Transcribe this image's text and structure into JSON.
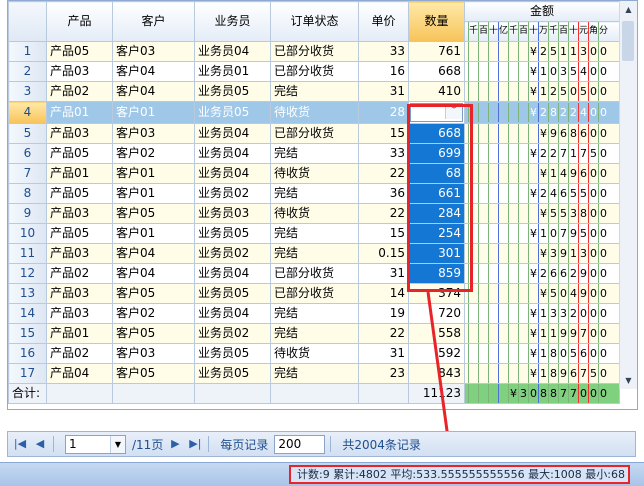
{
  "columns": {
    "product": "产品",
    "customer": "客户",
    "salesperson": "业务员",
    "status": "订单状态",
    "price": "单价",
    "qty": "数量",
    "amount": "金额",
    "amount_digits": [
      "千",
      "百",
      "十",
      "亿",
      "千",
      "百",
      "十",
      "万",
      "千",
      "百",
      "十",
      "元",
      "角",
      "分"
    ]
  },
  "rows": [
    {
      "n": "1",
      "product": "产品05",
      "customer": "客户03",
      "sales": "业务员04",
      "status": "已部分收货",
      "price": "33",
      "qty": "761",
      "amount": [
        "",
        "",
        "",
        "",
        "",
        "",
        "¥",
        "2",
        "5",
        "1",
        "1",
        "3",
        "0",
        "0"
      ]
    },
    {
      "n": "2",
      "product": "产品03",
      "customer": "客户04",
      "sales": "业务员01",
      "status": "已部分收货",
      "price": "16",
      "qty": "668",
      "amount": [
        "",
        "",
        "",
        "",
        "",
        "",
        "¥",
        "1",
        "0",
        "3",
        "5",
        "4",
        "0",
        "0"
      ]
    },
    {
      "n": "3",
      "product": "产品02",
      "customer": "客户04",
      "sales": "业务员05",
      "status": "完结",
      "price": "31",
      "qty": "410",
      "amount": [
        "",
        "",
        "",
        "",
        "",
        "",
        "¥",
        "1",
        "2",
        "5",
        "0",
        "5",
        "0",
        "0"
      ]
    },
    {
      "n": "4",
      "product": "产品01",
      "customer": "客户01",
      "sales": "业务员05",
      "status": "待收货",
      "price": "28",
      "qty": "1008",
      "amount": [
        "",
        "",
        "",
        "",
        "",
        "",
        "¥",
        "2",
        "8",
        "2",
        "2",
        "4",
        "0",
        "0"
      ]
    },
    {
      "n": "5",
      "product": "产品03",
      "customer": "客户03",
      "sales": "业务员04",
      "status": "已部分收货",
      "price": "15",
      "qty": "668",
      "amount": [
        "",
        "",
        "",
        "",
        "",
        "",
        "",
        "¥",
        "9",
        "6",
        "8",
        "6",
        "0",
        "0"
      ]
    },
    {
      "n": "6",
      "product": "产品05",
      "customer": "客户02",
      "sales": "业务员04",
      "status": "完结",
      "price": "33",
      "qty": "699",
      "amount": [
        "",
        "",
        "",
        "",
        "",
        "",
        "¥",
        "2",
        "2",
        "7",
        "1",
        "7",
        "5",
        "0"
      ]
    },
    {
      "n": "7",
      "product": "产品01",
      "customer": "客户01",
      "sales": "业务员04",
      "status": "待收货",
      "price": "22",
      "qty": "68",
      "amount": [
        "",
        "",
        "",
        "",
        "",
        "",
        "",
        "¥",
        "1",
        "4",
        "9",
        "6",
        "0",
        "0"
      ]
    },
    {
      "n": "8",
      "product": "产品05",
      "customer": "客户01",
      "sales": "业务员02",
      "status": "完结",
      "price": "36",
      "qty": "661",
      "amount": [
        "",
        "",
        "",
        "",
        "",
        "",
        "¥",
        "2",
        "4",
        "6",
        "5",
        "5",
        "0",
        "0"
      ]
    },
    {
      "n": "9",
      "product": "产品03",
      "customer": "客户05",
      "sales": "业务员03",
      "status": "待收货",
      "price": "22",
      "qty": "284",
      "amount": [
        "",
        "",
        "",
        "",
        "",
        "",
        "",
        "¥",
        "5",
        "5",
        "3",
        "8",
        "0",
        "0"
      ]
    },
    {
      "n": "10",
      "product": "产品05",
      "customer": "客户01",
      "sales": "业务员05",
      "status": "完结",
      "price": "15",
      "qty": "254",
      "amount": [
        "",
        "",
        "",
        "",
        "",
        "",
        "¥",
        "1",
        "0",
        "7",
        "9",
        "5",
        "0",
        "0"
      ]
    },
    {
      "n": "11",
      "product": "产品03",
      "customer": "客户04",
      "sales": "业务员02",
      "status": "完结",
      "price": "0.15",
      "qty": "301",
      "amount": [
        "",
        "",
        "",
        "",
        "",
        "",
        "",
        "¥",
        "3",
        "9",
        "1",
        "3",
        "0",
        "0"
      ]
    },
    {
      "n": "12",
      "product": "产品02",
      "customer": "客户04",
      "sales": "业务员04",
      "status": "已部分收货",
      "price": "31",
      "qty": "859",
      "amount": [
        "",
        "",
        "",
        "",
        "",
        "",
        "¥",
        "2",
        "6",
        "6",
        "2",
        "9",
        "0",
        "0"
      ]
    },
    {
      "n": "13",
      "product": "产品03",
      "customer": "客户05",
      "sales": "业务员05",
      "status": "已部分收货",
      "price": "14",
      "qty": "374",
      "amount": [
        "",
        "",
        "",
        "",
        "",
        "",
        "",
        "¥",
        "5",
        "0",
        "4",
        "9",
        "0",
        "0"
      ]
    },
    {
      "n": "14",
      "product": "产品03",
      "customer": "客户02",
      "sales": "业务员04",
      "status": "完结",
      "price": "19",
      "qty": "720",
      "amount": [
        "",
        "",
        "",
        "",
        "",
        "",
        "¥",
        "1",
        "3",
        "3",
        "2",
        "0",
        "0",
        "0"
      ]
    },
    {
      "n": "15",
      "product": "产品01",
      "customer": "客户05",
      "sales": "业务员02",
      "status": "完结",
      "price": "22",
      "qty": "558",
      "amount": [
        "",
        "",
        "",
        "",
        "",
        "",
        "¥",
        "1",
        "1",
        "9",
        "9",
        "7",
        "0",
        "0"
      ]
    },
    {
      "n": "16",
      "product": "产品02",
      "customer": "客户03",
      "sales": "业务员05",
      "status": "待收货",
      "price": "31",
      "qty": "592",
      "amount": [
        "",
        "",
        "",
        "",
        "",
        "",
        "¥",
        "1",
        "8",
        "0",
        "5",
        "6",
        "0",
        "0"
      ]
    },
    {
      "n": "17",
      "product": "产品04",
      "customer": "客户05",
      "sales": "业务员05",
      "status": "完结",
      "price": "23",
      "qty": "843",
      "amount": [
        "",
        "",
        "",
        "",
        "",
        "",
        "¥",
        "1",
        "8",
        "9",
        "6",
        "7",
        "5",
        "0"
      ]
    }
  ],
  "totals": {
    "label": "合计:",
    "qty": "11123",
    "amount": [
      "",
      "",
      "",
      "",
      "¥",
      "3",
      "0",
      "8",
      "8",
      "7",
      "7",
      "0",
      "0",
      "0"
    ]
  },
  "pager": {
    "page_value": "1",
    "total_pages": "/11页",
    "page_size_label": "每页记录",
    "page_size_value": "200",
    "total_records": "共2004条记录"
  },
  "status_summary": "计数:9 累计:4802 平均:533.555555555556 最大:1008 最小:68",
  "colors": {
    "highlight": "#e8232a",
    "selection": "#1477d4",
    "current_row": "#9ec7e8"
  }
}
